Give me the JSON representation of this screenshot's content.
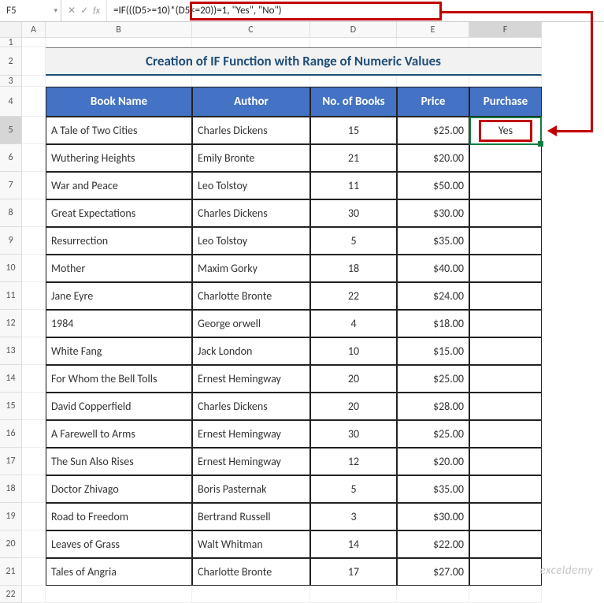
{
  "nameBox": "F5",
  "fbIcons": {
    "cancel": "✕",
    "enter": "✓",
    "fx": "fx"
  },
  "formula": "=IF(((D5>=10)*(D5<=20))=1, \"Yes\", \"No\")",
  "cols": [
    "A",
    "B",
    "C",
    "D",
    "E",
    "F"
  ],
  "rowNums": [
    "1",
    "2",
    "3",
    "4",
    "5",
    "6",
    "7",
    "8",
    "9",
    "10",
    "11",
    "12",
    "13",
    "14",
    "15",
    "16",
    "17",
    "18",
    "19",
    "20",
    "21",
    "22"
  ],
  "title": "Creation of IF Function with Range of Numeric Values",
  "headers": {
    "bookName": "Book Name",
    "author": "Author",
    "noBooks": "No. of Books",
    "price": "Price",
    "purchase": "Purchase"
  },
  "rowsData": [
    {
      "b": "A Tale of Two Cities",
      "a": "Charles Dickens",
      "n": "15",
      "p": "$25.00",
      "r": "Yes"
    },
    {
      "b": "Wuthering Heights",
      "a": "Emily Bronte",
      "n": "21",
      "p": "$20.00",
      "r": ""
    },
    {
      "b": "War and Peace",
      "a": "Leo Tolstoy",
      "n": "11",
      "p": "$50.00",
      "r": ""
    },
    {
      "b": "Great Expectations",
      "a": "Charles Dickens",
      "n": "30",
      "p": "$30.00",
      "r": ""
    },
    {
      "b": "Resurrection",
      "a": "Leo Tolstoy",
      "n": "5",
      "p": "$35.00",
      "r": ""
    },
    {
      "b": "Mother",
      "a": "Maxim Gorky",
      "n": "18",
      "p": "$40.00",
      "r": ""
    },
    {
      "b": "Jane Eyre",
      "a": "Charlotte Bronte",
      "n": "22",
      "p": "$24.00",
      "r": ""
    },
    {
      "b": "1984",
      "a": "George orwell",
      "n": "4",
      "p": "$18.00",
      "r": ""
    },
    {
      "b": "White Fang",
      "a": "Jack London",
      "n": "10",
      "p": "$15.00",
      "r": ""
    },
    {
      "b": "For Whom the Bell Tolls",
      "a": "Ernest Hemingway",
      "n": "20",
      "p": "$25.00",
      "r": ""
    },
    {
      "b": "David Copperfield",
      "a": "Charles Dickens",
      "n": "20",
      "p": "$28.00",
      "r": ""
    },
    {
      "b": "A Farewell to Arms",
      "a": "Ernest Hemingway",
      "n": "30",
      "p": "$25.00",
      "r": ""
    },
    {
      "b": "The Sun Also Rises",
      "a": "Ernest Hemingway",
      "n": "12",
      "p": "$20.00",
      "r": ""
    },
    {
      "b": "Doctor Zhivago",
      "a": "Boris Pasternak",
      "n": "5",
      "p": "$35.00",
      "r": ""
    },
    {
      "b": "Road to Freedom",
      "a": "Bertrand Russell",
      "n": "3",
      "p": "$30.00",
      "r": ""
    },
    {
      "b": "Leaves of Grass",
      "a": "Walt Whitman",
      "n": "14",
      "p": "$22.00",
      "r": ""
    },
    {
      "b": "Tales of Angria",
      "a": "Charlotte Bronte",
      "n": "17",
      "p": "$27.00",
      "r": ""
    }
  ],
  "watermark": "exceldemy"
}
